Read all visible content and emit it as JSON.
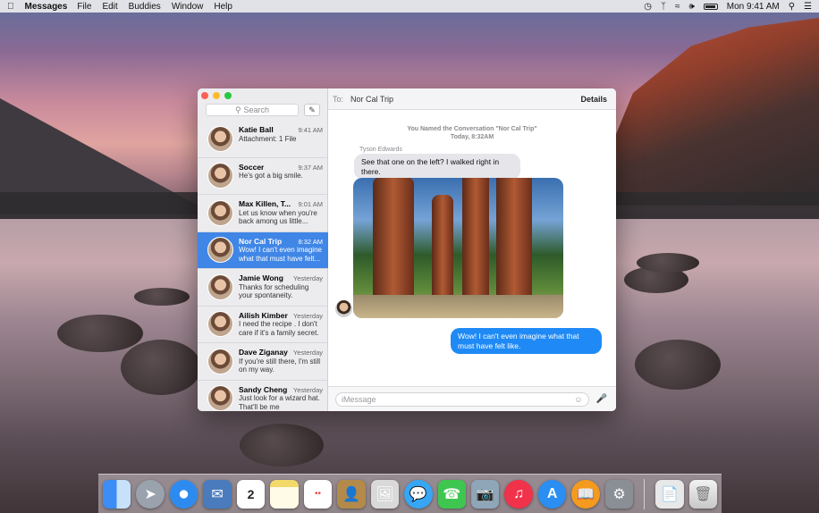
{
  "menubar": {
    "app_name": "Messages",
    "menus": [
      "File",
      "Edit",
      "Buddies",
      "Window",
      "Help"
    ],
    "clock": "Mon 9:41 AM"
  },
  "sidebar": {
    "search_placeholder": "Search",
    "conversations": [
      {
        "name": "Katie Ball",
        "time": "9:41 AM",
        "preview": "Attachment: 1 File",
        "selected": false
      },
      {
        "name": "Soccer",
        "time": "9:37 AM",
        "preview": "He's got a big smile.",
        "selected": false
      },
      {
        "name": "Max Killen, T...",
        "time": "9:01 AM",
        "preview": "Let us know when you're back among us little...",
        "selected": false
      },
      {
        "name": "Nor Cal Trip",
        "time": "8:32 AM",
        "preview": "Wow! I can't even imagine what that must have felt...",
        "selected": true
      },
      {
        "name": "Jamie Wong",
        "time": "Yesterday",
        "preview": "Thanks for scheduling your spontaneity.",
        "selected": false
      },
      {
        "name": "Ailish Kimber",
        "time": "Yesterday",
        "preview": "I need the recipe . I don't care if it's a family secret.",
        "selected": false
      },
      {
        "name": "Dave Ziganay",
        "time": "Yesterday",
        "preview": "If you're still there, I'm still on my way.",
        "selected": false
      },
      {
        "name": "Sandy Cheng",
        "time": "Yesterday",
        "preview": "Just look for a wizard hat. That'll be me",
        "selected": false
      }
    ]
  },
  "chat": {
    "to_label": "To:",
    "recipient": "Nor Cal Trip",
    "details_label": "Details",
    "system_message": "You Named the Conversation \"Nor Cal Trip\"",
    "system_time": "Today, 8:32AM",
    "sender_name": "Tyson Edwards",
    "incoming_message": "See that one on the left? I walked right in there.",
    "outgoing_message": "Wow! I can't even imagine what that must have felt like.",
    "composer_placeholder": "iMessage"
  },
  "dock": {
    "apps": [
      "finder-icon",
      "launchpad-icon",
      "safari-icon",
      "mail-icon",
      "calendar-icon",
      "notes-icon",
      "reminders-icon",
      "contacts-icon",
      "preview-icon",
      "messages-icon",
      "facetime-icon",
      "iphoto-icon",
      "itunes-icon",
      "app-store-icon",
      "ibooks-icon",
      "system-preferences-icon",
      "documents-folder-icon",
      "trash-icon"
    ],
    "calendar_day": "2"
  }
}
